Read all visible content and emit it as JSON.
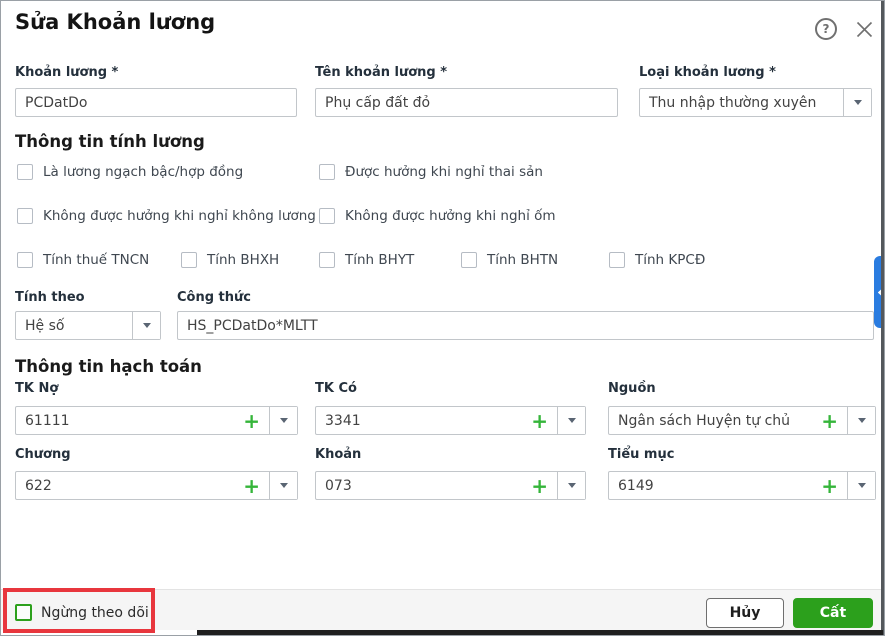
{
  "dialog": {
    "title": "Sửa Khoản lương"
  },
  "header": {
    "help_icon": "?"
  },
  "form": {
    "khoan_luong": {
      "label": "Khoản lương *",
      "value": "PCDatDo"
    },
    "ten_khoan_luong": {
      "label": "Tên khoản lương *",
      "value": "Phụ cấp đất đỏ"
    },
    "loai_khoan_luong": {
      "label": "Loại khoản lương *",
      "value": "Thu nhập thường xuyên"
    }
  },
  "salary_info": {
    "title": "Thông tin tính lương",
    "checkboxes": [
      {
        "label": "Là lương ngạch bậc/hợp đồng",
        "checked": false
      },
      {
        "label": "Được hưởng khi nghỉ thai sản",
        "checked": false
      },
      {
        "label": "Không được hưởng khi nghỉ không lương",
        "checked": false
      },
      {
        "label": "Không được hưởng khi nghỉ ốm",
        "checked": false
      },
      {
        "label": "Tính thuế TNCN",
        "checked": false
      },
      {
        "label": "Tính BHXH",
        "checked": false
      },
      {
        "label": "Tính BHYT",
        "checked": false
      },
      {
        "label": "Tính BHTN",
        "checked": false
      },
      {
        "label": "Tính KPCĐ",
        "checked": false
      }
    ],
    "tinh_theo": {
      "label": "Tính theo",
      "value": "Hệ số"
    },
    "cong_thuc": {
      "label": "Công thức",
      "value": "HS_PCDatDo*MLTT"
    }
  },
  "accounting_info": {
    "title": "Thông tin hạch toán",
    "fields": [
      {
        "label": "TK Nợ",
        "value": "61111"
      },
      {
        "label": "TK Có",
        "value": "3341"
      },
      {
        "label": "Nguồn",
        "value": "Ngân sách Huyện tự chủ"
      },
      {
        "label": "Chương",
        "value": "622"
      },
      {
        "label": "Khoản",
        "value": "073"
      },
      {
        "label": "Tiểu mục",
        "value": "6149"
      }
    ]
  },
  "footer": {
    "stop_tracking": {
      "label": "Ngừng theo dõi",
      "checked": false
    },
    "cancel_label": "Hủy",
    "save_label": "Cất"
  },
  "colors": {
    "accent_green": "#2ca01c",
    "plus_green": "#35b53a",
    "side_tab_blue": "#2a7ce0",
    "annotation_red": "#e8363d"
  }
}
